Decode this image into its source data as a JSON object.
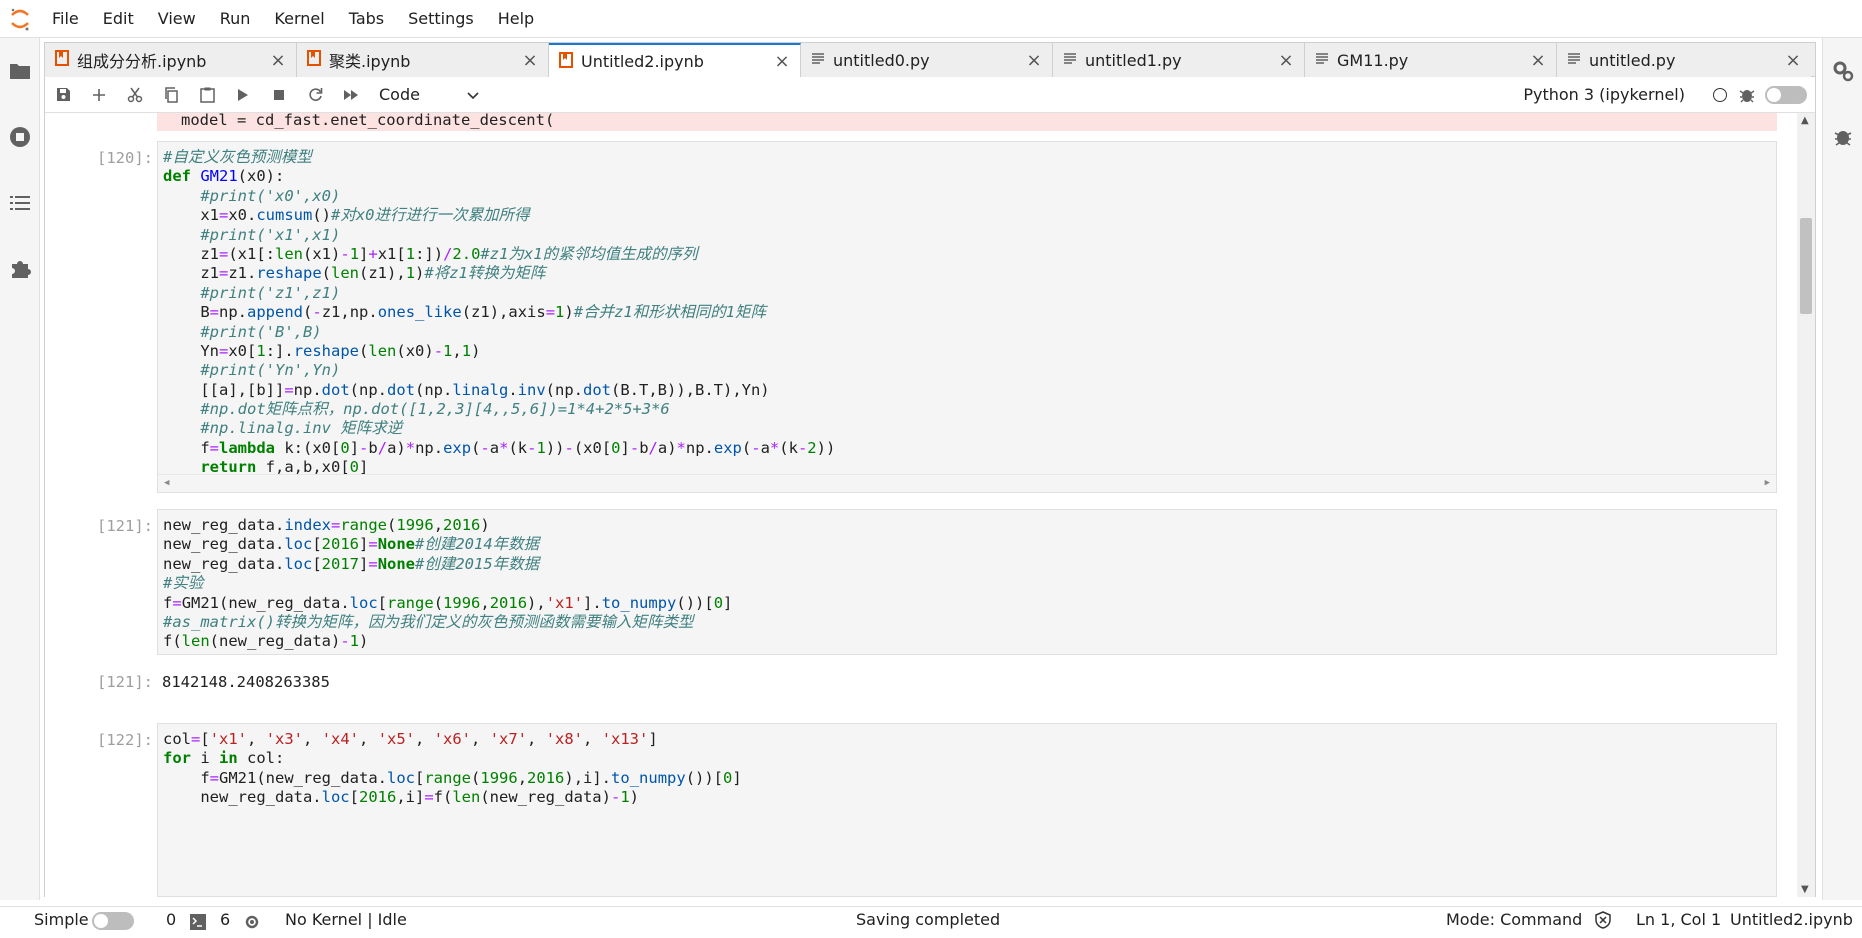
{
  "menubar": {
    "items": [
      "File",
      "Edit",
      "View",
      "Run",
      "Kernel",
      "Tabs",
      "Settings",
      "Help"
    ]
  },
  "tabs": [
    {
      "label": "组成分分析.ipynb",
      "icon": "notebook-icon"
    },
    {
      "label": "聚类.ipynb",
      "icon": "notebook-icon"
    },
    {
      "label": "Untitled2.ipynb",
      "icon": "notebook-icon"
    },
    {
      "label": "untitled0.py",
      "icon": "file-icon"
    },
    {
      "label": "untitled1.py",
      "icon": "file-icon"
    },
    {
      "label": "GM11.py",
      "icon": "file-icon"
    },
    {
      "label": "untitled.py",
      "icon": "file-icon"
    }
  ],
  "tab_close": "×",
  "toolbar": {
    "cell_type": "Code",
    "kernel_name": "Python 3 (ipykernel)"
  },
  "notebook": {
    "error_line": "model = cd_fast.enet_coordinate_descent(",
    "cell120_prompt": "[120]:",
    "cell121_prompt": "[121]:",
    "out121_prompt": "[121]:",
    "out121_value": "8142148.2408263385",
    "cell122_prompt": "[122]:"
  },
  "statusbar": {
    "mode_label": "Simple",
    "terminals": "0",
    "kernels": "6",
    "kernel_status": "No Kernel | Idle",
    "save_status": "Saving completed",
    "mode": "Mode: Command",
    "cursor": "Ln 1, Col 1",
    "filename": "Untitled2.ipynb"
  },
  "colors": {
    "accent": "#1976d2",
    "logo": "#f37726",
    "error_bg": "#fde2e2"
  }
}
